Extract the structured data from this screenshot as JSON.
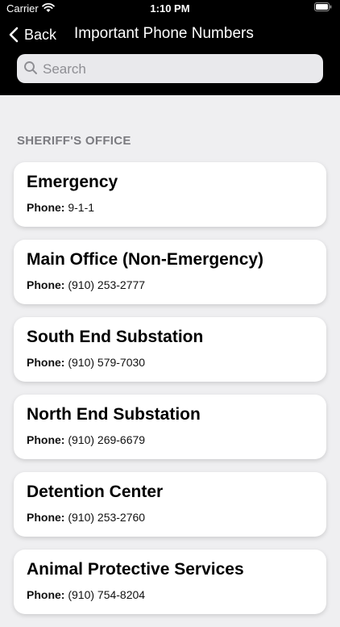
{
  "status_bar": {
    "carrier": "Carrier",
    "time": "1:10 PM"
  },
  "nav": {
    "back_label": "Back",
    "title": "Important Phone Numbers"
  },
  "search": {
    "placeholder": "Search",
    "value": ""
  },
  "section": {
    "header": "SHERIFF'S OFFICE"
  },
  "entries": [
    {
      "name": "Emergency",
      "phone_label": "Phone:",
      "phone": "9-1-1"
    },
    {
      "name": "Main Office (Non-Emergency)",
      "phone_label": "Phone:",
      "phone": "(910) 253-2777"
    },
    {
      "name": "South End Substation",
      "phone_label": "Phone:",
      "phone": "(910) 579-7030"
    },
    {
      "name": "North End Substation",
      "phone_label": "Phone:",
      "phone": "(910) 269-6679"
    },
    {
      "name": "Detention Center",
      "phone_label": "Phone:",
      "phone": "(910) 253-2760"
    },
    {
      "name": "Animal Protective Services",
      "phone_label": "Phone:",
      "phone": "(910) 754-8204"
    }
  ],
  "colors": {
    "header_bg": "#000000",
    "page_bg": "#efeff1",
    "card_bg": "#ffffff",
    "section_header": "#7b7b80"
  },
  "icons": [
    "wifi-icon",
    "battery-icon",
    "chevron-left-icon",
    "search-icon"
  ]
}
